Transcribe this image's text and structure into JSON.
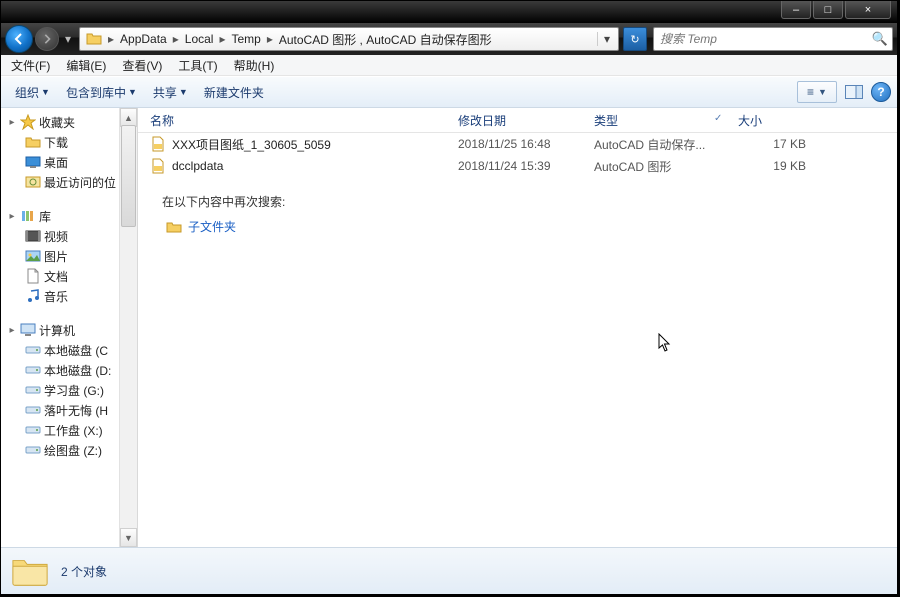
{
  "titlebar": {
    "min": "–",
    "max": "□",
    "close": "×"
  },
  "breadcrumb": {
    "segments": [
      "AppData",
      "Local",
      "Temp",
      "AutoCAD 图形 , AutoCAD 自动保存图形"
    ]
  },
  "search": {
    "placeholder": "搜索 Temp"
  },
  "menubar": {
    "file": "文件(F)",
    "edit": "编辑(E)",
    "view": "查看(V)",
    "tools": "工具(T)",
    "help": "帮助(H)"
  },
  "toolbar": {
    "organize": "组织",
    "include": "包含到库中",
    "share": "共享",
    "newfolder": "新建文件夹"
  },
  "columns": {
    "name": "名称",
    "date": "修改日期",
    "type": "类型",
    "size": "大小"
  },
  "files": [
    {
      "name": "XXX项目图纸_1_30605_5059",
      "date": "2018/11/25 16:48",
      "type": "AutoCAD 自动保存...",
      "size": "17 KB"
    },
    {
      "name": "dcclpdata",
      "date": "2018/11/24 15:39",
      "type": "AutoCAD 图形",
      "size": "19 KB"
    }
  ],
  "search_again": {
    "label": "在以下内容中再次搜索:",
    "subfolders": "子文件夹"
  },
  "sidebar": {
    "favorites": "收藏夹",
    "downloads": "下载",
    "desktop": "桌面",
    "recent": "最近访问的位",
    "libraries": "库",
    "videos": "视频",
    "pictures": "图片",
    "documents": "文档",
    "music": "音乐",
    "computer": "计算机",
    "c": "本地磁盘 (C",
    "d": "本地磁盘 (D:",
    "g": "学习盘 (G:)",
    "h": "落叶无悔 (H",
    "x": "工作盘 (X:)",
    "z": "绘图盘 (Z:)"
  },
  "statusbar": {
    "count": "2 个对象"
  }
}
